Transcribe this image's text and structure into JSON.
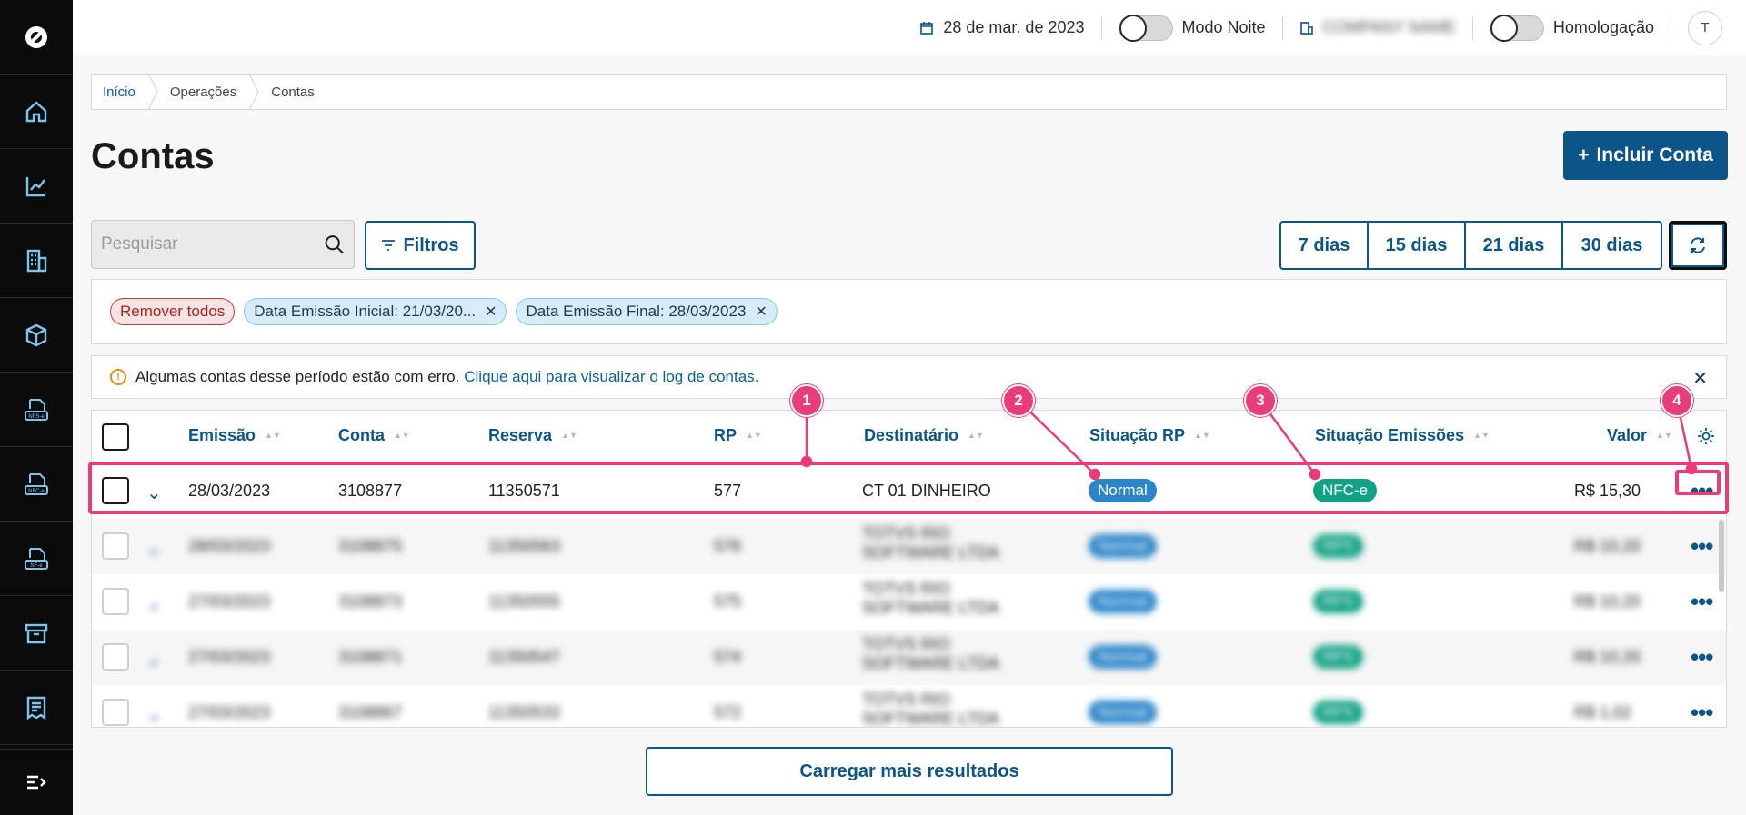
{
  "topbar": {
    "date": "28 de mar. de 2023",
    "night_mode_label": "Modo Noite",
    "company": "COMPANY NAME",
    "homologation_label": "Homologação",
    "avatar_initial": "T"
  },
  "sidebar": {
    "items": [
      {
        "icon": "home-icon"
      },
      {
        "icon": "chart-icon"
      },
      {
        "icon": "building-icon"
      },
      {
        "icon": "cube-icon"
      },
      {
        "icon": "nfse-icon",
        "text": "NFS-e"
      },
      {
        "icon": "nfce-icon",
        "text": "NFC-e"
      },
      {
        "icon": "nfe-icon",
        "text": "NF-e"
      },
      {
        "icon": "archive-icon"
      },
      {
        "icon": "receipt-icon"
      }
    ]
  },
  "breadcrumb": {
    "items": [
      "Início",
      "Operações",
      "Contas"
    ]
  },
  "page": {
    "title": "Contas",
    "add_button": "Incluir Conta"
  },
  "toolbar": {
    "search_placeholder": "Pesquisar",
    "filters_label": "Filtros",
    "day_buttons": [
      "7 dias",
      "15 dias",
      "21 dias",
      "30 dias"
    ]
  },
  "chips": {
    "remove_all": "Remover todos",
    "filters": [
      "Data Emissão Inicial: 21/03/20...",
      "Data Emissão Final: 28/03/2023"
    ]
  },
  "alert": {
    "message": "Algumas contas desse período estão com erro.",
    "link": "Clique aqui para visualizar o log de contas."
  },
  "table": {
    "columns": [
      "Emissão",
      "Conta",
      "Reserva",
      "RP",
      "Destinatário",
      "Situação RP",
      "Situação Emissões",
      "Valor"
    ],
    "rows": [
      {
        "emissao": "28/03/2023",
        "conta": "3108877",
        "reserva": "11350571",
        "rp": "577",
        "destinatario": "CT 01 DINHEIRO",
        "situacao_rp": "Normal",
        "situacao_emissoes": "NFC-e",
        "valor": "R$ 15,30"
      },
      {
        "emissao": "28/03/2023",
        "conta": "3108875",
        "reserva": "11350563",
        "rp": "576",
        "destinatario": "TOTVS RIO SOFTWARE LTDA",
        "situacao_rp": "Normal",
        "situacao_emissoes": "RPS",
        "valor": "R$ 10,20"
      },
      {
        "emissao": "27/03/2023",
        "conta": "3108873",
        "reserva": "11350555",
        "rp": "575",
        "destinatario": "TOTVS RIO SOFTWARE LTDA",
        "situacao_rp": "Normal",
        "situacao_emissoes": "RPS",
        "valor": "R$ 10,20"
      },
      {
        "emissao": "27/03/2023",
        "conta": "3108871",
        "reserva": "11350547",
        "rp": "574",
        "destinatario": "TOTVS RIO SOFTWARE LTDA",
        "situacao_rp": "Normal",
        "situacao_emissoes": "RPS",
        "valor": "R$ 10,20"
      },
      {
        "emissao": "27/03/2023",
        "conta": "3108867",
        "reserva": "11350533",
        "rp": "572",
        "destinatario": "TOTVS RIO SOFTWARE LTDA",
        "situacao_rp": "Normal",
        "situacao_emissoes": "RPS",
        "valor": "R$ 1,02"
      }
    ]
  },
  "annotations": [
    "1",
    "2",
    "3",
    "4"
  ],
  "load_more_label": "Carregar mais resultados",
  "colors": {
    "primary": "#0c5589",
    "annotation": "#e83d76",
    "badge_blue": "#2a85c9",
    "badge_green": "#12a184",
    "sidebar": "#0b0b0b"
  }
}
